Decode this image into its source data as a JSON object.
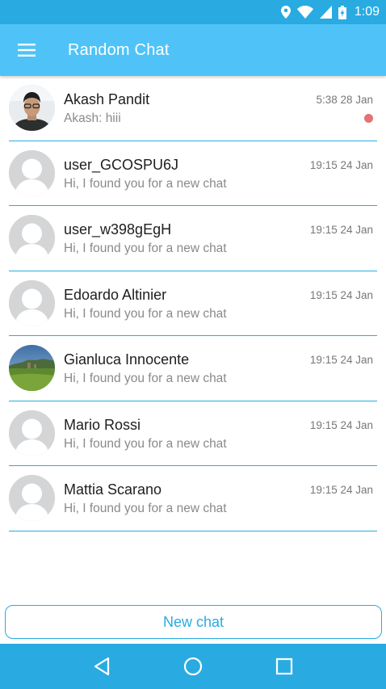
{
  "status_bar": {
    "time": "1:09",
    "icons": [
      "location-icon",
      "wifi-icon",
      "signal-icon",
      "battery-charging-icon"
    ]
  },
  "app_bar": {
    "title": "Random Chat",
    "menu_icon": "hamburger-menu-icon"
  },
  "chats": [
    {
      "name": "Akash Pandit",
      "preview": "Akash: hiii",
      "time": "5:38 28 Jan",
      "unread": true,
      "avatar": "photo-person"
    },
    {
      "name": "user_GCOSPU6J",
      "preview": "Hi, I found you for a new chat",
      "time": "19:15 24 Jan",
      "unread": false,
      "avatar": "default"
    },
    {
      "name": "user_w398gEgH",
      "preview": "Hi, I found you for a new chat",
      "time": "19:15 24 Jan",
      "unread": false,
      "avatar": "default"
    },
    {
      "name": "Edoardo Altinier",
      "preview": "Hi, I found you for a new chat",
      "time": "19:15 24 Jan",
      "unread": false,
      "avatar": "default"
    },
    {
      "name": "Gianluca Innocente",
      "preview": "Hi, I found you for a new chat",
      "time": "19:15 24 Jan",
      "unread": false,
      "avatar": "photo-landscape"
    },
    {
      "name": "Mario Rossi",
      "preview": "Hi, I found you for a new chat",
      "time": "19:15 24 Jan",
      "unread": false,
      "avatar": "default"
    },
    {
      "name": "Mattia Scarano",
      "preview": "Hi, I found you for a new chat",
      "time": "19:15 24 Jan",
      "unread": false,
      "avatar": "default"
    }
  ],
  "new_chat_button": {
    "label": "New chat"
  },
  "nav_bar": {
    "buttons": [
      "back-icon",
      "home-icon",
      "recents-icon"
    ]
  },
  "colors": {
    "primary_dark": "#29abe2",
    "primary": "#4fc3f7",
    "unread": "#e57373",
    "divider": "#29abe2"
  }
}
